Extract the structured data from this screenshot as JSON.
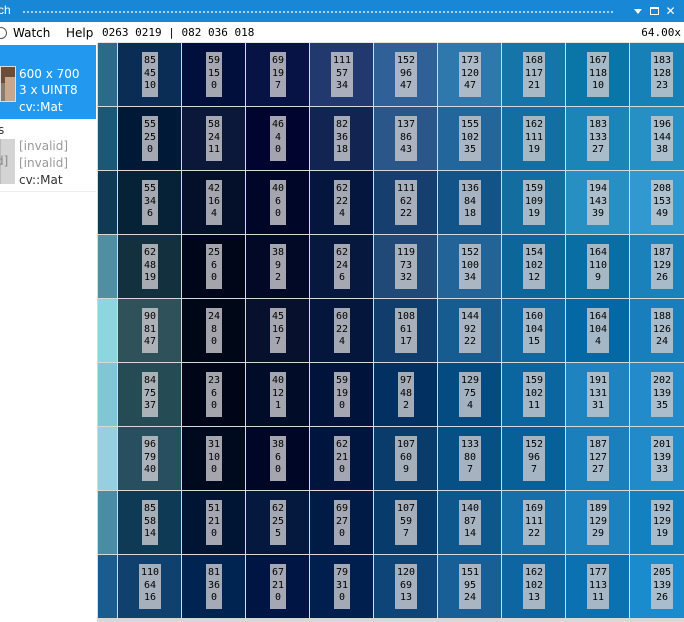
{
  "window": {
    "title": "ch",
    "buttons": {
      "dropdown_icon": "triangle-down",
      "maximize_icon": "maximize",
      "close_label": "✕"
    }
  },
  "menu": {
    "watch_label": "Watch",
    "help_label": "Help"
  },
  "info": {
    "coordinates": "0263 0219 | 082 036 018",
    "zoom": "64.00x"
  },
  "panel": {
    "selected": {
      "size": "600 x 700",
      "format": "3 x UINT8",
      "type": "cv::Mat"
    },
    "fragment_s": "s",
    "fragment_d": "d]",
    "invalid_item": {
      "line1": "[invalid]",
      "line2": "[invalid]",
      "type": "cv::Mat"
    }
  },
  "pixel_grid": {
    "channel_order": "BGR",
    "edge_column_colors": [
      "#2c6a8c",
      "#1b5878",
      "#0f3a55",
      "#4f8fa1",
      "#8dd5df",
      "#80c6d4",
      "#96cfdf",
      "#4a8ca6",
      "#1a5c8e"
    ],
    "rows": [
      [
        [
          85,
          45,
          10
        ],
        [
          59,
          15,
          0
        ],
        [
          69,
          19,
          7
        ],
        [
          111,
          57,
          34
        ],
        [
          152,
          96,
          47
        ],
        [
          173,
          120,
          47
        ],
        [
          168,
          117,
          21
        ],
        [
          167,
          118,
          10
        ],
        [
          183,
          128,
          23
        ]
      ],
      [
        [
          55,
          25,
          0
        ],
        [
          58,
          24,
          11
        ],
        [
          46,
          4,
          0
        ],
        [
          82,
          36,
          18
        ],
        [
          137,
          86,
          43
        ],
        [
          155,
          102,
          35
        ],
        [
          162,
          111,
          19
        ],
        [
          183,
          133,
          27
        ],
        [
          196,
          144,
          38
        ]
      ],
      [
        [
          55,
          34,
          6
        ],
        [
          42,
          16,
          4
        ],
        [
          40,
          6,
          0
        ],
        [
          62,
          22,
          4
        ],
        [
          111,
          62,
          22
        ],
        [
          136,
          84,
          18
        ],
        [
          159,
          109,
          19
        ],
        [
          194,
          143,
          39
        ],
        [
          208,
          153,
          49
        ]
      ],
      [
        [
          62,
          48,
          19
        ],
        [
          25,
          6,
          0
        ],
        [
          38,
          9,
          2
        ],
        [
          62,
          24,
          6
        ],
        [
          119,
          73,
          32
        ],
        [
          152,
          100,
          34
        ],
        [
          154,
          102,
          12
        ],
        [
          164,
          110,
          9
        ],
        [
          187,
          129,
          26
        ]
      ],
      [
        [
          90,
          81,
          47
        ],
        [
          24,
          8,
          0
        ],
        [
          45,
          16,
          7
        ],
        [
          60,
          22,
          4
        ],
        [
          108,
          61,
          17
        ],
        [
          144,
          92,
          22
        ],
        [
          160,
          104,
          15
        ],
        [
          164,
          104,
          4
        ],
        [
          188,
          126,
          24
        ]
      ],
      [
        [
          84,
          75,
          37
        ],
        [
          23,
          6,
          0
        ],
        [
          40,
          12,
          1
        ],
        [
          59,
          19,
          0
        ],
        [
          97,
          48,
          2
        ],
        [
          129,
          75,
          4
        ],
        [
          159,
          102,
          11
        ],
        [
          191,
          131,
          31
        ],
        [
          202,
          139,
          35
        ]
      ],
      [
        [
          96,
          79,
          40
        ],
        [
          31,
          10,
          0
        ],
        [
          38,
          6,
          0
        ],
        [
          62,
          21,
          0
        ],
        [
          107,
          60,
          9
        ],
        [
          133,
          80,
          7
        ],
        [
          152,
          96,
          7
        ],
        [
          187,
          127,
          27
        ],
        [
          201,
          139,
          33
        ]
      ],
      [
        [
          85,
          58,
          14
        ],
        [
          51,
          21,
          0
        ],
        [
          62,
          25,
          5
        ],
        [
          69,
          27,
          0
        ],
        [
          107,
          59,
          7
        ],
        [
          140,
          87,
          14
        ],
        [
          169,
          111,
          22
        ],
        [
          189,
          129,
          29
        ],
        [
          192,
          129,
          19
        ]
      ],
      [
        [
          110,
          64,
          16
        ],
        [
          81,
          36,
          0
        ],
        [
          67,
          21,
          0
        ],
        [
          79,
          31,
          0
        ],
        [
          120,
          69,
          13
        ],
        [
          151,
          95,
          24
        ],
        [
          162,
          102,
          13
        ],
        [
          177,
          113,
          11
        ],
        [
          205,
          139,
          26
        ]
      ]
    ]
  }
}
